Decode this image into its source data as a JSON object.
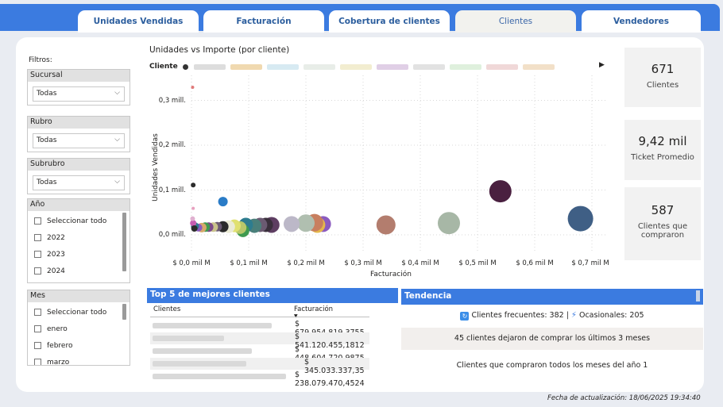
{
  "tabs": [
    {
      "label": "Unidades Vendidas",
      "active": false
    },
    {
      "label": "Facturación",
      "active": false
    },
    {
      "label": "Cobertura de clientes",
      "active": false
    },
    {
      "label": "Clientes",
      "active": true
    },
    {
      "label": "Vendedores",
      "active": false
    }
  ],
  "filters": {
    "title": "Filtros:",
    "sucursal": {
      "label": "Sucursal",
      "value": "Todas"
    },
    "rubro": {
      "label": "Rubro",
      "value": "Todas"
    },
    "subrubro": {
      "label": "Subrubro",
      "value": "Todas"
    },
    "anio": {
      "label": "Año",
      "options": [
        "Seleccionar todo",
        "2022",
        "2023",
        "2024"
      ]
    },
    "mes": {
      "label": "Mes",
      "options": [
        "Seleccionar todo",
        "enero",
        "febrero",
        "marzo"
      ]
    }
  },
  "chart": {
    "title": "Unidades vs Importe (por cliente)",
    "legend_label": "Cliente",
    "ylabel": "Unidades Vendidas",
    "xlabel": "Facturación",
    "yticks": [
      "0,0 mill.",
      "0,1 mill.",
      "0,2 mill.",
      "0,3 mill."
    ],
    "xticks": [
      "$ 0,0 mil M",
      "$ 0,1 mil M",
      "$ 0,2 mil M",
      "$ 0,3 mil M",
      "$ 0,4 mil M",
      "$ 0,5 mil M",
      "$ 0,6 mil M",
      "$ 0,7 mil M"
    ]
  },
  "chart_data": {
    "type": "scatter",
    "title": "Unidades vs Importe (por cliente)",
    "xlabel": "Facturación",
    "ylabel": "Unidades Vendidas",
    "x_unit": "mil M $",
    "y_unit": "mill.",
    "xlim": [
      0,
      0.73
    ],
    "ylim": [
      0,
      0.32
    ],
    "points": [
      {
        "x": 0.68,
        "y": 0.022,
        "size": 16,
        "color": "#3f5f85"
      },
      {
        "x": 0.54,
        "y": 0.083,
        "size": 14,
        "color": "#4a2040"
      },
      {
        "x": 0.45,
        "y": 0.012,
        "size": 14,
        "color": "#a7b7a6"
      },
      {
        "x": 0.34,
        "y": 0.008,
        "size": 12,
        "color": "#b37d6e"
      },
      {
        "x": 0.23,
        "y": 0.01,
        "size": 10,
        "color": "#8b5bbf"
      },
      {
        "x": 0.22,
        "y": 0.008,
        "size": 10,
        "color": "#e5b84a"
      },
      {
        "x": 0.215,
        "y": 0.013,
        "size": 11,
        "color": "#c87f5f"
      },
      {
        "x": 0.2,
        "y": 0.012,
        "size": 11,
        "color": "#b0bfb0"
      },
      {
        "x": 0.175,
        "y": 0.01,
        "size": 10,
        "color": "#bcb8c8"
      },
      {
        "x": 0.14,
        "y": 0.008,
        "size": 10,
        "color": "#5e3e62"
      },
      {
        "x": 0.13,
        "y": 0.008,
        "size": 9,
        "color": "#3a2f3c"
      },
      {
        "x": 0.12,
        "y": 0.008,
        "size": 9,
        "color": "#6b5a72"
      },
      {
        "x": 0.11,
        "y": 0.006,
        "size": 9,
        "color": "#4a7f7a"
      },
      {
        "x": 0.095,
        "y": 0.008,
        "size": 9,
        "color": "#2d7c8f"
      },
      {
        "x": 0.09,
        "y": -0.005,
        "size": 8,
        "color": "#3f9a4f"
      },
      {
        "x": 0.085,
        "y": 0.002,
        "size": 8,
        "color": "#b7c76a"
      },
      {
        "x": 0.075,
        "y": 0.006,
        "size": 8,
        "color": "#e0e070"
      },
      {
        "x": 0.065,
        "y": 0.004,
        "size": 8,
        "color": "#ebebd6"
      },
      {
        "x": 0.055,
        "y": 0.004,
        "size": 7,
        "color": "#2b2b2b"
      },
      {
        "x": 0.045,
        "y": 0.004,
        "size": 6,
        "color": "#6b5a72"
      },
      {
        "x": 0.038,
        "y": 0.003,
        "size": 6,
        "color": "#c9c28a"
      },
      {
        "x": 0.03,
        "y": 0.003,
        "size": 6,
        "color": "#7c4a8a"
      },
      {
        "x": 0.024,
        "y": 0.003,
        "size": 6,
        "color": "#3f9a4f"
      },
      {
        "x": 0.018,
        "y": 0.002,
        "size": 6,
        "color": "#d7a86a"
      },
      {
        "x": 0.012,
        "y": 0.002,
        "size": 5,
        "color": "#8b5bbf"
      },
      {
        "x": 0.006,
        "y": 0.005,
        "size": 5,
        "color": "#2d7c8f"
      },
      {
        "x": 0.003,
        "y": 0.012,
        "size": 4,
        "color": "#c65db1"
      },
      {
        "x": 0.002,
        "y": 0.022,
        "size": 3,
        "color": "#e0b0d0"
      },
      {
        "x": 0.005,
        "y": 0.0,
        "size": 4,
        "color": "#2b2b2b"
      },
      {
        "x": 0.055,
        "y": 0.06,
        "size": 6,
        "color": "#2a7cc7"
      },
      {
        "x": 0.003,
        "y": 0.097,
        "size": 3,
        "color": "#2b2b2b"
      },
      {
        "x": 0.003,
        "y": 0.045,
        "size": 2,
        "color": "#e8a0c0"
      },
      {
        "x": 0.002,
        "y": 0.315,
        "size": 2,
        "color": "#e07a7a"
      }
    ]
  },
  "kpis": [
    {
      "value": "671",
      "label": "Clientes"
    },
    {
      "value": "9,42 mil",
      "label": "Ticket Promedio"
    },
    {
      "value": "587",
      "label": "Clientes que compraron"
    }
  ],
  "top5": {
    "title": "Top 5 de mejores clientes",
    "col_clientes": "Clientes",
    "col_facturacion": "Facturación",
    "rows": [
      {
        "value": "$ 679.954.819,3755"
      },
      {
        "value": "$ 541.120.455,1812"
      },
      {
        "value": "$ 448.604.720,9875"
      },
      {
        "value": "$ 345.033.337,35"
      },
      {
        "value": "$ 238.079.470,4524"
      }
    ]
  },
  "tendencia": {
    "title": "Tendencia",
    "frecuentes": "Clientes frecuentes: 382 |",
    "ocasionales": "Ocasionales: 205",
    "dejaron": "45 clientes dejaron de comprar los últimos 3 meses",
    "todos": "Clientes que compraron todos los meses del año 1"
  },
  "updated": "Fecha de actualización: 18/06/2025 19:34:40"
}
